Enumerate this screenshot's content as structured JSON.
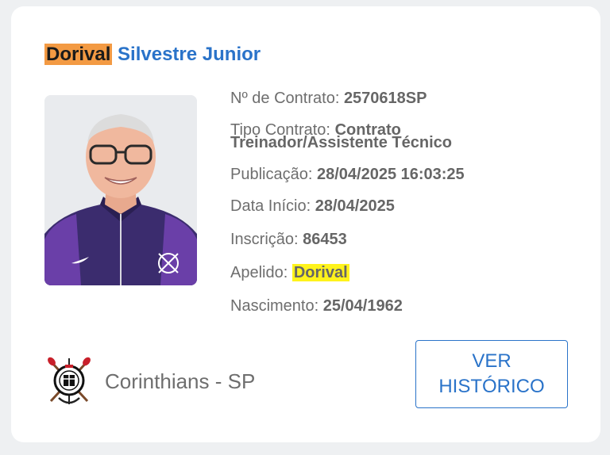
{
  "person": {
    "first_name": "Dorival",
    "rest_name": " Silvestre Junior"
  },
  "contract": {
    "number_label": "Nº de Contrato:",
    "number_value": "2570618SP",
    "type_label": "Tipo Contrato:",
    "type_value_1": "Contrato",
    "type_value_2": "Treinador/Assistente Técnico",
    "publication_label": "Publicação:",
    "publication_value": "28/04/2025 16:03:25",
    "start_label": "Data Início:",
    "start_value": "28/04/2025",
    "registration_label": "Inscrição:",
    "registration_value": "86453",
    "nickname_label": "Apelido:",
    "nickname_value": "Dorival",
    "birth_label": "Nascimento:",
    "birth_value": "25/04/1962"
  },
  "club": {
    "name": "Corinthians - SP"
  },
  "button": {
    "history_label": "VER HISTÓRICO"
  },
  "colors": {
    "accent": "#2a73c9",
    "highlight_orange": "#f39a43",
    "highlight_yellow": "#fff31c"
  }
}
